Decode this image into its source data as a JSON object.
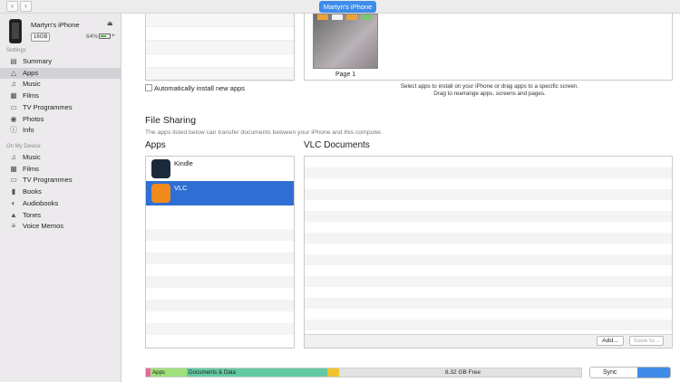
{
  "topbar": {
    "back_icon": "chevron-left",
    "forward_icon": "chevron-right",
    "device_pill": "Martyn's iPhone"
  },
  "device": {
    "name": "Martyn's iPhone",
    "capacity": "16GB",
    "battery_pct": "64%",
    "battery_level": 0.64,
    "eject_icon": "eject",
    "charge_icon": "plus"
  },
  "sidebar": {
    "settings_header": "Settings",
    "settings_items": [
      {
        "label": "Summary",
        "icon": "summary"
      },
      {
        "label": "Apps",
        "icon": "apps"
      },
      {
        "label": "Music",
        "icon": "music-note"
      },
      {
        "label": "Films",
        "icon": "film"
      },
      {
        "label": "TV Programmes",
        "icon": "tv"
      },
      {
        "label": "Photos",
        "icon": "camera"
      },
      {
        "label": "Info",
        "icon": "info"
      }
    ],
    "device_header": "On My Device",
    "device_items": [
      {
        "label": "Music",
        "icon": "music-note"
      },
      {
        "label": "Films",
        "icon": "film"
      },
      {
        "label": "TV Programmes",
        "icon": "tv"
      },
      {
        "label": "Books",
        "icon": "book"
      },
      {
        "label": "Audiobooks",
        "icon": "audiobook"
      },
      {
        "label": "Tones",
        "icon": "bell"
      },
      {
        "label": "Voice Memos",
        "icon": "voice-memo"
      }
    ],
    "selected": "Apps"
  },
  "home_screens": {
    "page_label": "Page 1"
  },
  "auto_install": {
    "label": "Automatically install new apps",
    "checked": false
  },
  "hint": {
    "line1": "Select apps to install on your iPhone or drag apps to a specific screen.",
    "line2": "Drag to rearrange apps, screens and pages."
  },
  "file_sharing": {
    "title": "File Sharing",
    "description": "The apps listed below can transfer documents between your iPhone and this computer.",
    "apps_header": "Apps",
    "docs_header": "VLC Documents",
    "apps": [
      {
        "name": "Kindle",
        "selected": false,
        "color": "#1b2a3a"
      },
      {
        "name": "VLC",
        "selected": true,
        "color": "#f08a1c"
      }
    ],
    "add_button": "Add...",
    "save_button": "Save to..."
  },
  "capacity_bar": {
    "segments": [
      {
        "label": "",
        "color": "#e56b9a"
      },
      {
        "label": "Apps",
        "color": "#9fe07a"
      },
      {
        "label": "Documents & Data",
        "color": "#63c9a2"
      },
      {
        "label": "",
        "color": "#f2c12e"
      }
    ],
    "free_label": "8.32 GB Free",
    "sync_button": "Sync"
  }
}
